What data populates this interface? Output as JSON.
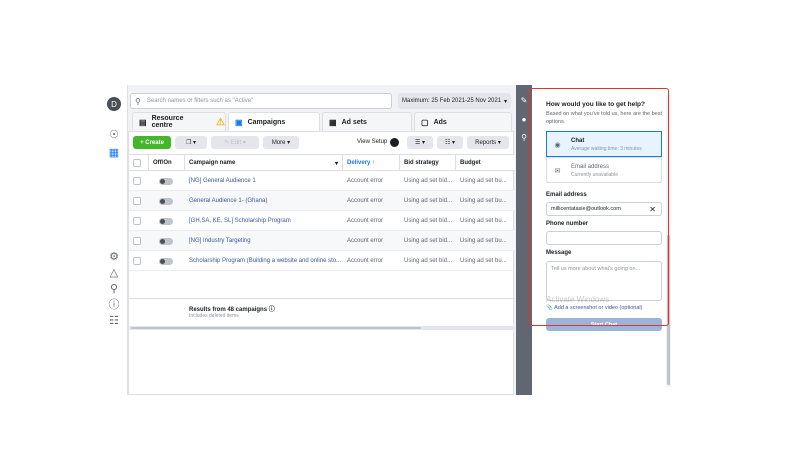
{
  "search": {
    "placeholder": "Search names or filters such as \"Active\""
  },
  "date_range": {
    "label": "Maximum: 25 Feb 2021-25 Nov 2021"
  },
  "left_nav": {
    "avatar_letter": "D"
  },
  "tabs": [
    {
      "label": "Resource centre",
      "icon": "document-icon"
    },
    {
      "label": "Campaigns",
      "icon": "folder-icon"
    },
    {
      "label": "Ad sets",
      "icon": "grid-icon"
    },
    {
      "label": "Ads",
      "icon": "ad-icon"
    }
  ],
  "toolbar": {
    "create": "Create",
    "edit": "Edit",
    "more": "More",
    "view_setup": "View Setup",
    "reports": "Reports"
  },
  "table": {
    "headers": {
      "onoff": "Off/On",
      "campaign": "Campaign name",
      "delivery": "Delivery",
      "bid": "Bid strategy",
      "budget": "Budget"
    },
    "rows": [
      {
        "name": "[NG] General Audience 1",
        "delivery": "Account error",
        "bid": "Using ad set bid...",
        "budget": "Using ad set bu..."
      },
      {
        "name": "General Audience 1- (Ghana)",
        "delivery": "Account error",
        "bid": "Using ad set bid...",
        "budget": "Using ad set bu..."
      },
      {
        "name": "[GH,SA, KE, SL] Scholarship Program",
        "delivery": "Account error",
        "bid": "Using ad set bid...",
        "budget": "Using ad set bu..."
      },
      {
        "name": "[NG] Industry Targeting",
        "delivery": "Account error",
        "bid": "Using ad set bid...",
        "budget": "Using ad set bu..."
      },
      {
        "name": "Scholarship Program (Building a website and online sto...",
        "delivery": "Account error",
        "bid": "Using ad set bid...",
        "budget": "Using ad set bu..."
      }
    ],
    "results": "Results from 48 campaigns",
    "results_note": "Includes deleted items"
  },
  "help": {
    "title": "How would you like to get help?",
    "subtitle": "Based on what you've told us, here are the best options.",
    "options": [
      {
        "title": "Chat",
        "sub": "Average waiting time: 3 minutes",
        "icon": "chat-icon"
      },
      {
        "title": "Email address",
        "sub": "Currently unavailable",
        "icon": "mail-icon"
      }
    ],
    "email_label": "Email address",
    "email_value": "millicentatasie@outlook.com",
    "phone_label": "Phone number",
    "message_label": "Message",
    "message_placeholder": "Tell us more about what's going on...",
    "attach": "Add a screenshot or video (optional)",
    "start_chat": "Start Chat",
    "watermark": "Activate Windows"
  },
  "colors": {
    "accent": "#1877f2",
    "create": "#42b72a",
    "annotation": "#e0342c"
  }
}
